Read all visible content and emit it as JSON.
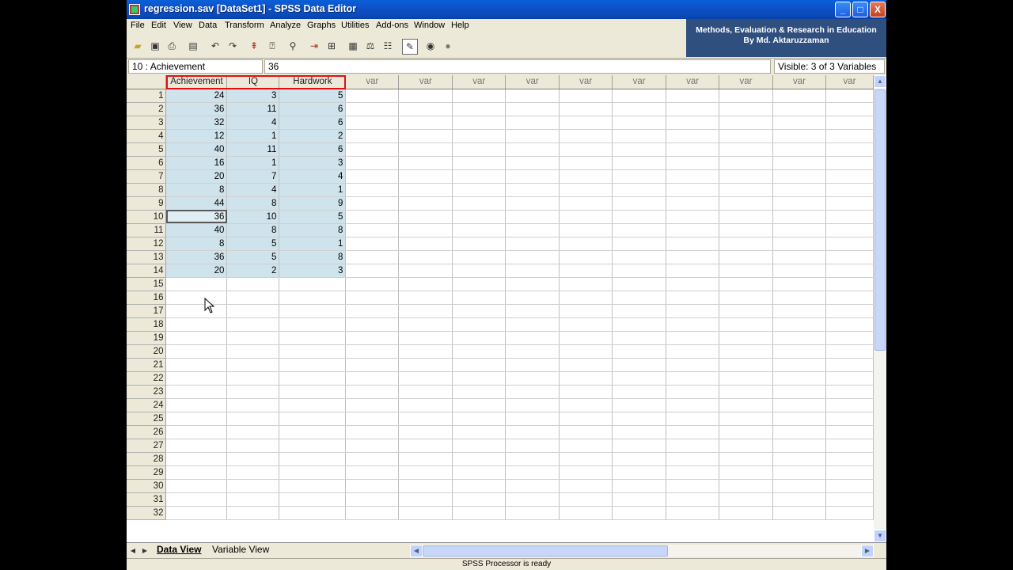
{
  "window": {
    "title": "regression.sav [DataSet1] - SPSS Data Editor",
    "controls": {
      "minimize": "_",
      "maximize": "□",
      "close": "X"
    }
  },
  "menubar": [
    "File",
    "Edit",
    "View",
    "Data",
    "Transform",
    "Analyze",
    "Graphs",
    "Utilities",
    "Add-ons",
    "Window",
    "Help"
  ],
  "banner": {
    "line1": "Methods, Evaluation & Research in Education",
    "line2": "By Md. Aktaruzzaman"
  },
  "toolbar_icons": [
    "open-icon",
    "save-icon",
    "print-icon",
    "dialog-recall-icon",
    "undo-icon",
    "redo-icon",
    "goto-case-icon",
    "variables-icon",
    "find-icon",
    "insert-cases-icon",
    "insert-variable-icon",
    "split-file-icon",
    "weight-cases-icon",
    "select-cases-icon",
    "value-labels-icon",
    "use-sets-icon",
    "show-all-icon"
  ],
  "cellbar": {
    "cell_ref": "10 : Achievement",
    "cell_value": "36",
    "visible": "Visible: 3 of 3 Variables"
  },
  "grid": {
    "columns": [
      "Achievement",
      "IQ",
      "Hardwork",
      "var",
      "var",
      "var",
      "var",
      "var",
      "var",
      "var",
      "var",
      "var",
      "var"
    ],
    "row_count": 32,
    "rows": [
      [
        "24",
        "3",
        "5"
      ],
      [
        "36",
        "11",
        "6"
      ],
      [
        "32",
        "4",
        "6"
      ],
      [
        "12",
        "1",
        "2"
      ],
      [
        "40",
        "11",
        "6"
      ],
      [
        "16",
        "1",
        "3"
      ],
      [
        "20",
        "7",
        "4"
      ],
      [
        "8",
        "4",
        "1"
      ],
      [
        "44",
        "8",
        "9"
      ],
      [
        "36",
        "10",
        "5"
      ],
      [
        "40",
        "8",
        "8"
      ],
      [
        "8",
        "5",
        "1"
      ],
      [
        "36",
        "5",
        "8"
      ],
      [
        "20",
        "2",
        "3"
      ]
    ],
    "selected_cell": {
      "row": 10,
      "col": 1
    }
  },
  "tabs": {
    "data_view": "Data View",
    "variable_view": "Variable View"
  },
  "status": "SPSS Processor is ready",
  "colors": {
    "title_bar": "#0a5fd9",
    "banner": "#2f4f7f",
    "highlight_box": "#e01010",
    "data_cell": "#cfe3ec"
  }
}
